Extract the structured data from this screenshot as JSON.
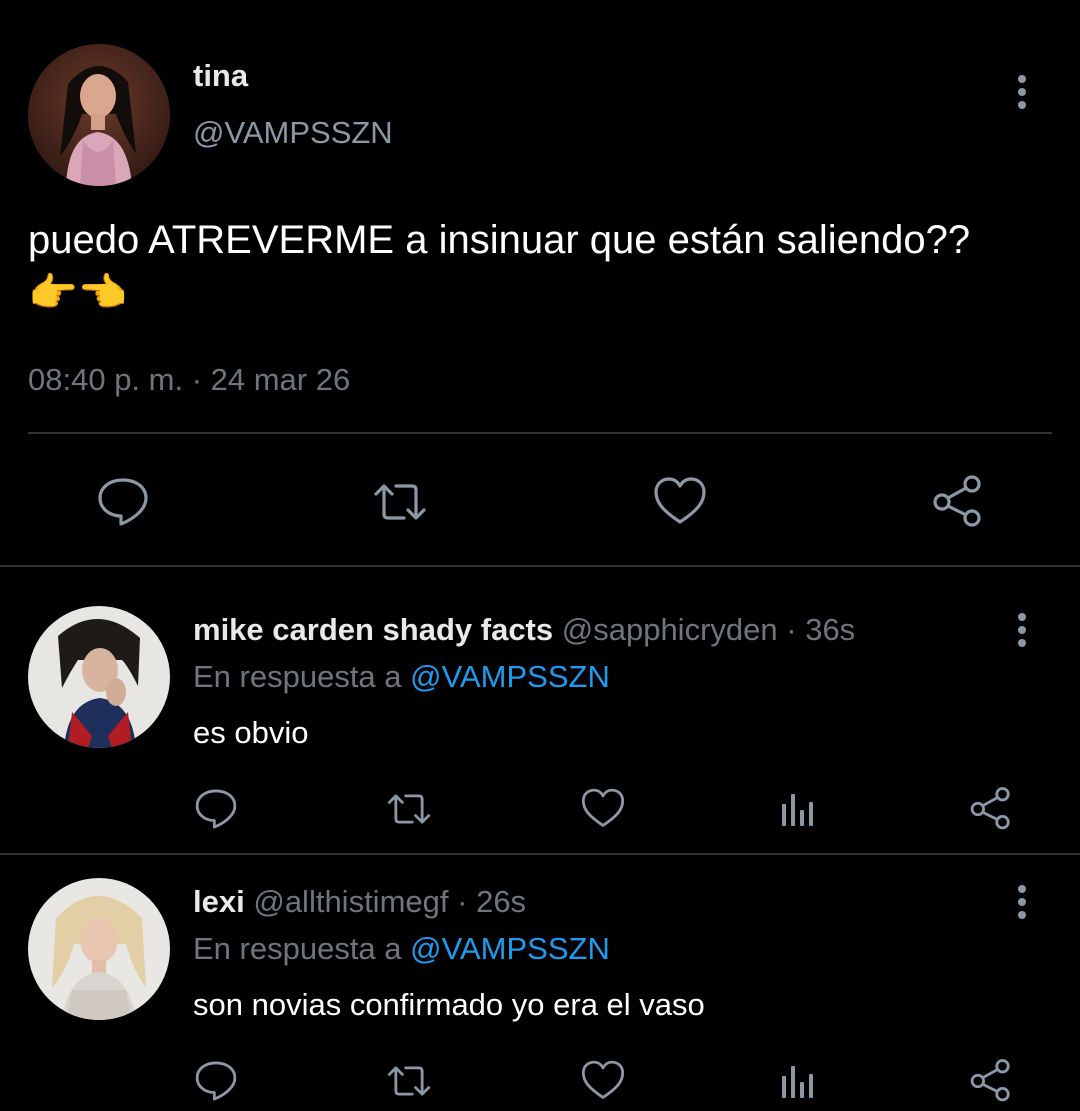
{
  "main_tweet": {
    "display_name": "tina",
    "handle": "@VAMPSSZN",
    "text": "puedo ATREVERME a insinuar que están saliendo?? 👉👈",
    "timestamp": "08:40 p. m. · 24 mar 26",
    "actions": [
      "reply",
      "retweet",
      "like",
      "share"
    ]
  },
  "replies": [
    {
      "display_name": "mike carden shady facts",
      "handle": "@sapphicryden",
      "separator": "·",
      "time": "36s",
      "reply_prefix": "En respuesta a",
      "reply_mention": "@VAMPSSZN",
      "text": "es obvio"
    },
    {
      "display_name": "lexi",
      "handle": "@allthistimegf",
      "separator": "·",
      "time": "26s",
      "reply_prefix": "En respuesta a",
      "reply_mention": "@VAMPSSZN",
      "text": "son novias confirmado yo era el vaso"
    }
  ],
  "icons": {
    "reply": "speech-bubble-icon",
    "retweet": "retweet-arrows-icon",
    "like": "heart-icon",
    "analytics": "bar-chart-icon",
    "share": "share-nodes-icon",
    "more": "vertical-ellipsis-icon"
  },
  "colors": {
    "background": "#000000",
    "primary_text": "#e7e9ea",
    "secondary_text": "#6e767d",
    "link": "#1d9bf0",
    "divider": "#2f3336",
    "icon": "#8b98a5"
  }
}
